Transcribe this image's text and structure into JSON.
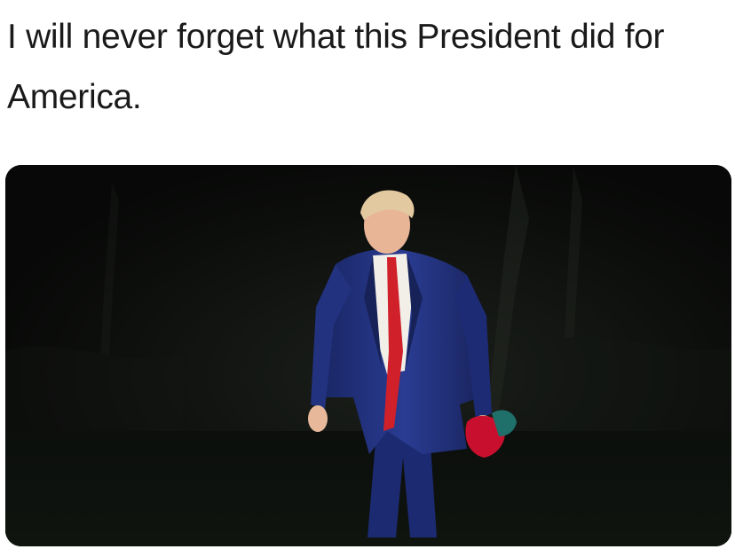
{
  "caption": {
    "text": "I will never forget what this President did for America."
  },
  "photo": {
    "alt": "Man in a blue suit with untied red tie walking at night holding a red cap",
    "colors": {
      "background": "#0a0b0a",
      "suit": "#1f2f7a",
      "shirt": "#f2efe9",
      "tie": "#d0202a",
      "cap": "#c8102e"
    }
  }
}
